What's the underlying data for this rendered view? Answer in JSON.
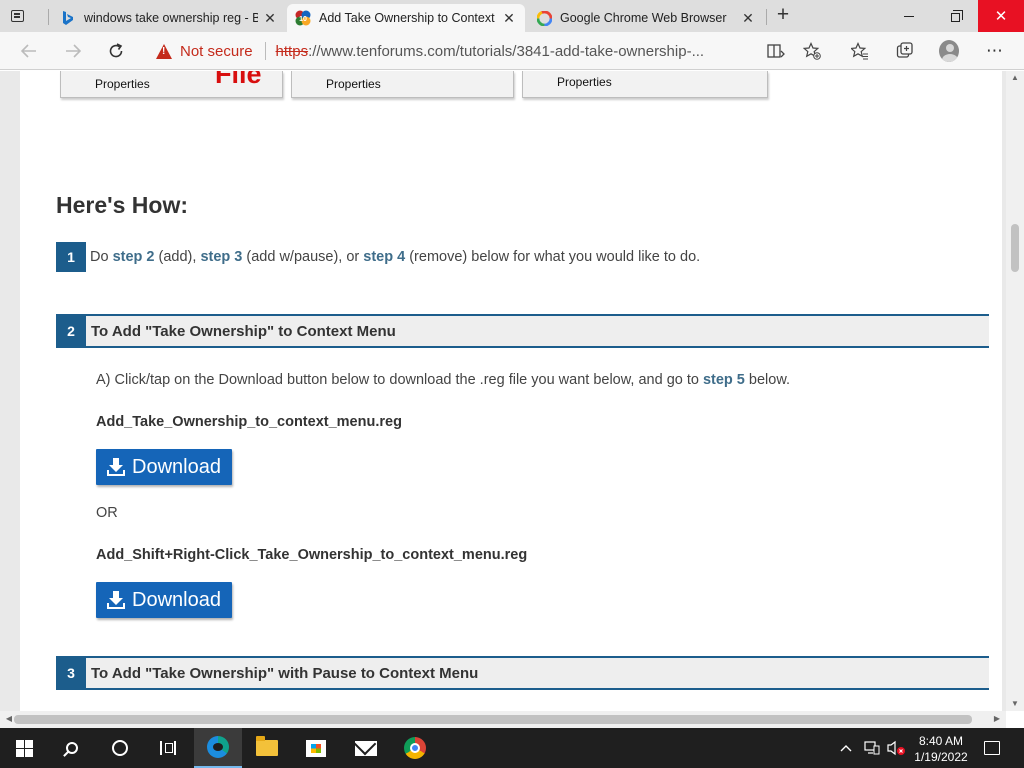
{
  "browser": {
    "tabs": [
      {
        "title": "windows take ownership reg - Bi",
        "favicon": "bing-icon",
        "active": false
      },
      {
        "title": "Add Take Ownership to Context I",
        "favicon": "tenforums-icon",
        "active": true
      },
      {
        "title": "Google Chrome Web Browser",
        "favicon": "google-icon",
        "active": false
      }
    ],
    "address": {
      "security_label": "Not secure",
      "url_scheme": "https",
      "url_rest": "://www.tenforums.com/tutorials/3841-add-take-ownership-..."
    }
  },
  "page": {
    "cards": [
      {
        "label": "Properties"
      },
      {
        "label": "Properties"
      },
      {
        "label": "Properties"
      }
    ],
    "file_text": "File",
    "howto_title": "Here's How:",
    "step1": {
      "num": "1",
      "do": "Do ",
      "step2": "step 2",
      "add": " (add), ",
      "step3": "step 3",
      "pause": " (add w/pause), or ",
      "step4": "step 4",
      "remove": " (remove) below for what you would like to do."
    },
    "section2": {
      "num": "2",
      "title": "To Add \"Take Ownership\" to Context Menu",
      "instruction_a": "A) Click/tap on the Download button below to download the .reg file you want below, and go to ",
      "instruction_step": "step 5",
      "instruction_b": " below.",
      "file1": "Add_Take_Ownership_to_context_menu.reg",
      "download_label": "Download",
      "or_text": "OR",
      "file2": "Add_Shift+Right-Click_Take_Ownership_to_context_menu.reg"
    },
    "section3": {
      "num": "3",
      "title": "To Add \"Take Ownership\" with Pause to Context Menu"
    }
  },
  "taskbar": {
    "time": "8:40 AM",
    "date": "1/19/2022"
  },
  "colors": {
    "accent": "#1c5d8c",
    "download_button": "#1565b8",
    "warning": "#c42b1c",
    "close_button": "#e81123"
  }
}
